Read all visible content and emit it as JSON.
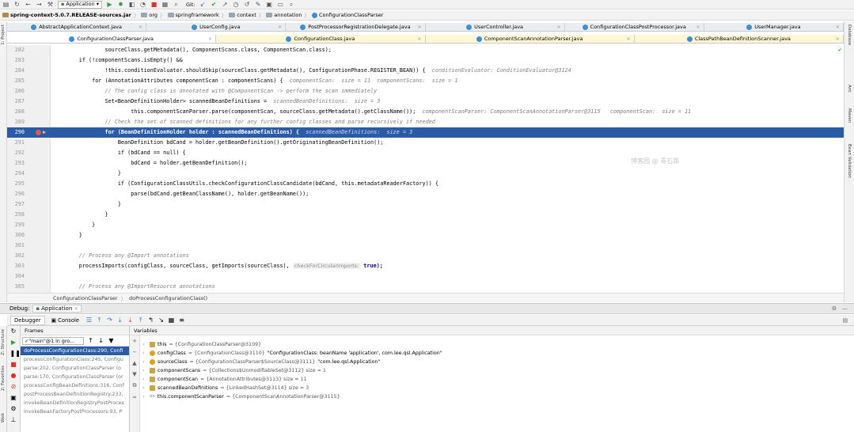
{
  "toolbar": {
    "run_config": "Application",
    "git_label": "Git:"
  },
  "nav": {
    "crumbs": [
      "spring-context-5.0.7.RELEASE-sources.jar",
      "org",
      "springframework",
      "context",
      "annotation",
      "ConfigurationClassParser"
    ]
  },
  "left_strip": {
    "project": "1: Project"
  },
  "right_strip": {
    "maven": "Maven",
    "ant": "Ant",
    "database": "Database",
    "bean": "Bean Validation"
  },
  "tabs_row1": [
    {
      "label": "AbstractApplicationContext.java"
    },
    {
      "label": "UserConfig.java"
    },
    {
      "label": "PostProcessorRegistrationDelegate.java"
    },
    {
      "label": "UserController.java"
    },
    {
      "label": "ConfigurationClassPostProcessor.java"
    },
    {
      "label": "UserManager.java"
    }
  ],
  "tabs_row2": [
    {
      "label": "ConfigurationClassParser.java"
    },
    {
      "label": "ConfigurationClass.java"
    },
    {
      "label": "ComponentScanAnnotationParser.java"
    },
    {
      "label": "ClassPathBeanDefinitionScanner.java"
    }
  ],
  "editor": {
    "line_numbers": [
      "282",
      "283",
      "284",
      "285",
      "286",
      "287",
      "288",
      "289",
      "290",
      "291",
      "292",
      "293",
      "294",
      "295",
      "296",
      "297",
      "298",
      "299",
      "300",
      "301",
      "302",
      "303",
      "304",
      "305"
    ],
    "code": [
      "                sourceClass.getMetadata(), ComponentScans.class, ComponentScan.class);",
      "        if (!componentScans.isEmpty() &&",
      "                !this.conditionEvaluator.shouldSkip(sourceClass.getMetadata(), ConfigurationPhase.REGISTER_BEAN)) {",
      "            for (AnnotationAttributes componentScan : componentScans) {",
      "                // The config class is annotated with @ComponentScan -> perform the scan immediately",
      "                Set<BeanDefinitionHolder> scannedBeanDefinitions =",
      "                        this.componentScanParser.parse(componentScan, sourceClass.getMetadata().getClassName());",
      "                // Check the set of scanned definitions for any further config classes and parse recursively if needed",
      "                for (BeanDefinitionHolder holder : scannedBeanDefinitions) {",
      "                    BeanDefinition bdCand = holder.getBeanDefinition().getOriginatingBeanDefinition();",
      "                    if (bdCand == null) {",
      "                        bdCand = holder.getBeanDefinition();",
      "                    }",
      "                    if (ConfigurationClassUtils.checkConfigurationClassCandidate(bdCand, this.metadataReaderFactory)) {",
      "                        parse(bdCand.getBeanClassName(), holder.getBeanName());",
      "                    }",
      "                }",
      "            }",
      "        }",
      "",
      "        // Process any @Import annotations",
      "        processImports(configClass, sourceClass, getImports(sourceClass), ",
      "",
      "        // Process any @ImportResource annotations"
    ],
    "hints": {
      "h284": "conditionEvaluator: ConditionEvaluator@3124",
      "h285": "componentScan:  size = 11  componentScans:  size = 1",
      "h287": "scannedBeanDefinitions:  size = 3",
      "h288": "componentScanParser: ComponentScanAnnotationParser@3115   componentScan:  size = 11",
      "h290": "scannedBeanDefinitions:  size = 3",
      "h303_param": "checkForCircularImports:",
      "h303_val": "true);"
    },
    "watermark": "博客园 @ 青石路"
  },
  "editor_breadcrumbs": [
    "ConfigurationClassParser",
    "doProcessConfigurationClass()"
  ],
  "debug": {
    "title": "Debug:",
    "session": "Application",
    "tabs": {
      "debugger": "Debugger",
      "console": "Console"
    },
    "frames_title": "Frames",
    "variables_title": "Variables",
    "thread": "\"main\"@1 in gro...",
    "frames": [
      "doProcessConfigurationClass:290, Confi",
      "processConfigurationClass:245, Configu",
      "parse:202, ConfigurationClassParser (o",
      "parse:170, ConfigurationClassParser (or",
      "processConfigBeanDefinitions:316, Conf",
      "postProcessBeanDefinitionRegistry:233,",
      "invokeBeanDefinitionRegistryPostProces",
      "invokeBeanFactoryPostProcessors:93, P"
    ],
    "variables": [
      {
        "name": "this",
        "value": " = {ConfigurationClassParser@3109}",
        "extra": ""
      },
      {
        "name": "configClass",
        "value": " = {ConfigurationClass@3110}",
        "extra": " \"ConfigurationClass: beanName 'application', com.lee.qsl.Application\""
      },
      {
        "name": "sourceClass",
        "value": " = {ConfigurationClassParser$SourceClass@3111}",
        "extra": " \"com.lee.qsl.Application\""
      },
      {
        "name": "componentScans",
        "value": " = {Collections$UnmodifiableSet@3112}  size = 1",
        "extra": ""
      },
      {
        "name": "componentScan",
        "value": " = {AnnotationAttributes@3113}  size = 11",
        "extra": ""
      },
      {
        "name": "scannedBeanDefinitions",
        "value": " = {LinkedHashSet@3114}  size = 3",
        "extra": ""
      },
      {
        "name": "this.componentScanParser",
        "value": " = {ComponentScanAnnotationParser@3115}",
        "extra": ""
      }
    ],
    "left_labels": {
      "structure": "Z: Structure",
      "favorites": "2: Favorites",
      "web": "Web"
    }
  }
}
